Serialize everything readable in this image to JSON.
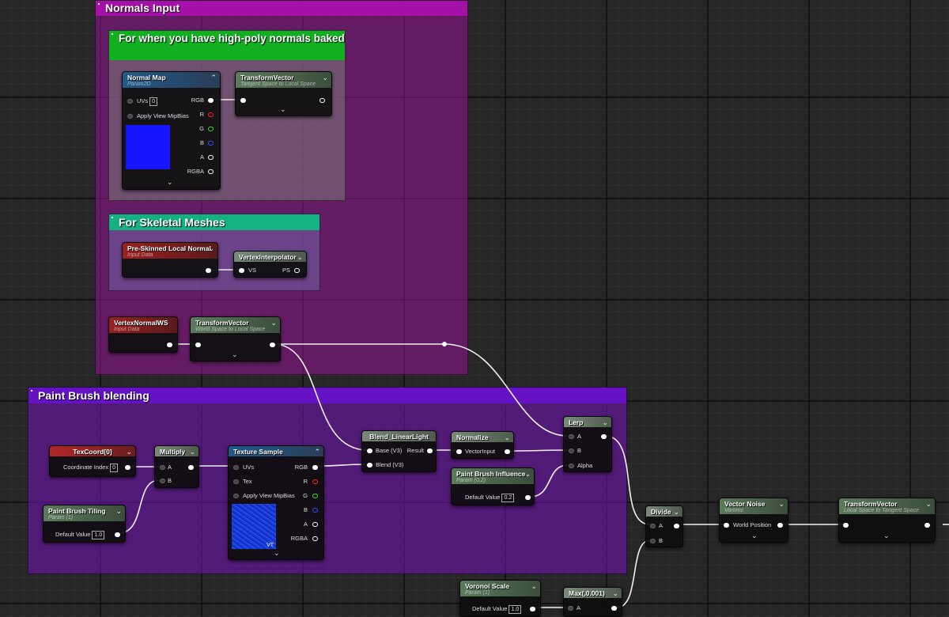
{
  "comments": {
    "normals_input": "Normals Input",
    "high_poly": "For when you have high-poly normals baked",
    "skeletal": "For Skeletal Meshes",
    "paint_brush": "Paint Brush blending"
  },
  "nodes": {
    "normal_map": {
      "title": "Normal Map",
      "subtitle": "Param2D",
      "uvs_label": "UVs",
      "uvs_value": "0",
      "mip_label": "Apply View MipBias",
      "outputs": [
        "RGB",
        "R",
        "G",
        "B",
        "A",
        "RGBA"
      ],
      "swatch_color": "#1515ff"
    },
    "transform_vector_1": {
      "title": "TransformVector",
      "subtitle": "Tangent Space to Local Space"
    },
    "preskinned": {
      "title": "Pre-Skinned Local Normal",
      "subtitle": "Input Data"
    },
    "vertex_interpolator": {
      "title": "VertexInterpolator",
      "in_label": "VS",
      "out_label": "PS"
    },
    "vertex_normal_ws": {
      "title": "VertexNormalWS",
      "subtitle": "Input Data"
    },
    "transform_vector_2": {
      "title": "TransformVector",
      "subtitle": "World Space to Local Space"
    },
    "texcoord": {
      "title": "TexCoord[0]",
      "label": "Coordinate Index",
      "value": "0"
    },
    "multiply": {
      "title": "Multiply",
      "a": "A",
      "b": "B"
    },
    "paint_tiling": {
      "title": "Paint Brush Tiling",
      "subtitle": "Param (1)",
      "label": "Default Value",
      "value": "1.0"
    },
    "texture_sample": {
      "title": "Texture Sample",
      "uvs_label": "UVs",
      "tex_label": "Tex",
      "mip_label": "Apply View MipBias",
      "outputs": [
        "RGB",
        "R",
        "G",
        "B",
        "A",
        "RGBA"
      ],
      "vt_label": "VT"
    },
    "blend": {
      "title": "Blend_LinearLight",
      "base": "Base (V3)",
      "blend": "Blend (V3)",
      "result": "Result"
    },
    "normalize": {
      "title": "Normalize",
      "label": "VectorInput"
    },
    "influence": {
      "title": "Paint Brush Influence",
      "subtitle": "Param (0.2)",
      "label": "Default Value",
      "value": "0.2"
    },
    "lerp": {
      "title": "Lerp",
      "a": "A",
      "b": "B",
      "alpha": "Alpha"
    },
    "divide": {
      "title": "Divide",
      "a": "A",
      "b": "B"
    },
    "vector_noise": {
      "title": "Vector Noise",
      "subtitle": "Voronoi",
      "label": "World Position"
    },
    "transform_vector_3": {
      "title": "TransformVector",
      "subtitle": "Local Space to Tangent Space"
    },
    "voronoi_scale": {
      "title": "Voronoi Scale",
      "subtitle": "Param (1)",
      "label": "Default Value",
      "value": "1.0"
    },
    "max": {
      "title": "Max(,0.001)",
      "a": "A"
    }
  },
  "colors": {
    "comment_magenta": "#a010a8",
    "comment_green": "#10b020",
    "comment_teal": "#10b080",
    "comment_purple": "#6010c0"
  }
}
